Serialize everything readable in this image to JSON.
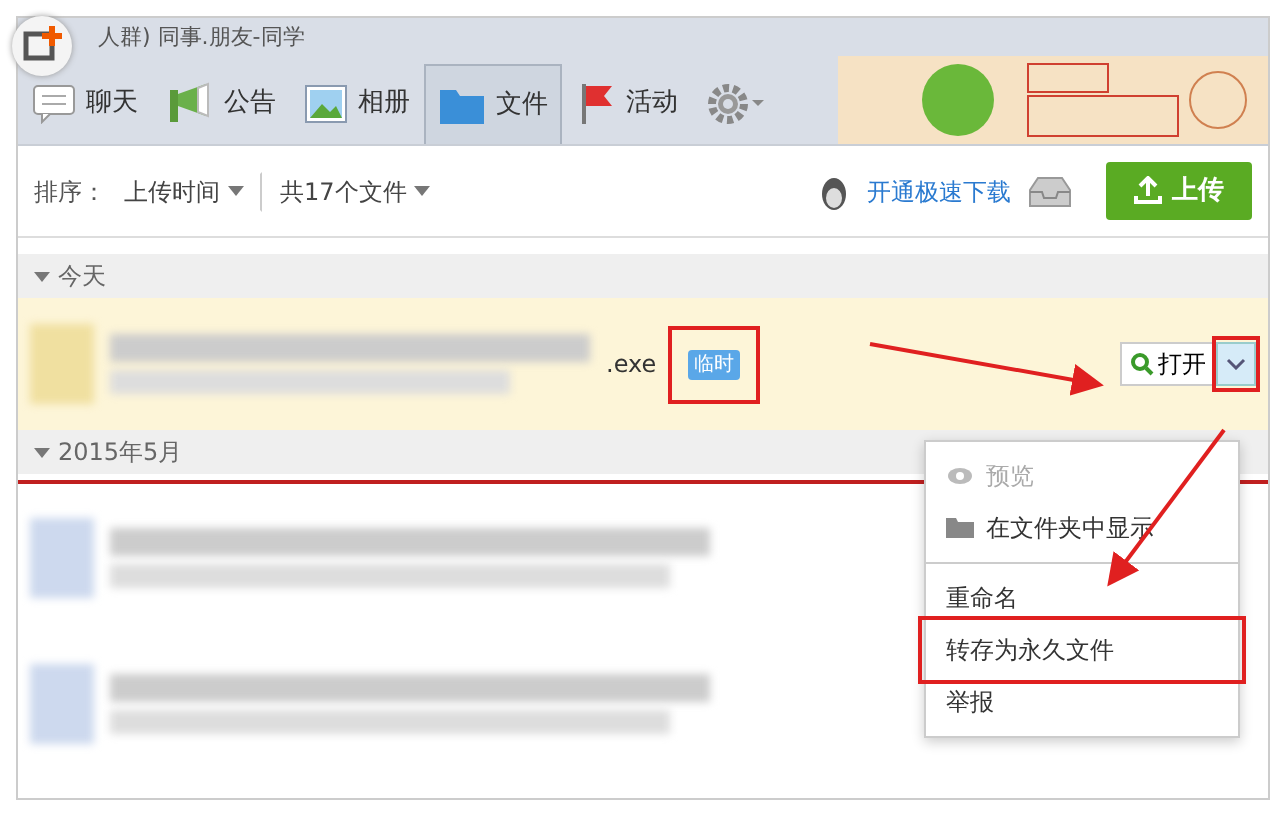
{
  "window": {
    "title": "人群) 同事.朋友-同学"
  },
  "tabs": [
    {
      "label": "聊天",
      "selected": false
    },
    {
      "label": "公告",
      "selected": false
    },
    {
      "label": "相册",
      "selected": false
    },
    {
      "label": "文件",
      "selected": true
    },
    {
      "label": "活动",
      "selected": false
    }
  ],
  "toolbar": {
    "sort_label": "排序：",
    "sort_value": "上传时间",
    "count": "共17个文件",
    "speed_link": "开通极速下载",
    "upload_button": "上传"
  },
  "groups": [
    {
      "title": "今天",
      "files": [
        {
          "extension": ".exe",
          "tag": "临时",
          "open_button": "打开",
          "highlighted": true
        }
      ]
    },
    {
      "title": "2015年5月",
      "files": [
        {
          "highlighted": false
        },
        {
          "highlighted": false
        }
      ]
    }
  ],
  "menu": [
    {
      "label": "预览",
      "disabled": true
    },
    {
      "label": "在文件夹中显示",
      "disabled": false
    },
    {
      "label": "重命名",
      "disabled": false,
      "divider_before": true
    },
    {
      "label": "转存为永久文件",
      "disabled": false
    },
    {
      "label": "举报",
      "disabled": false
    }
  ]
}
